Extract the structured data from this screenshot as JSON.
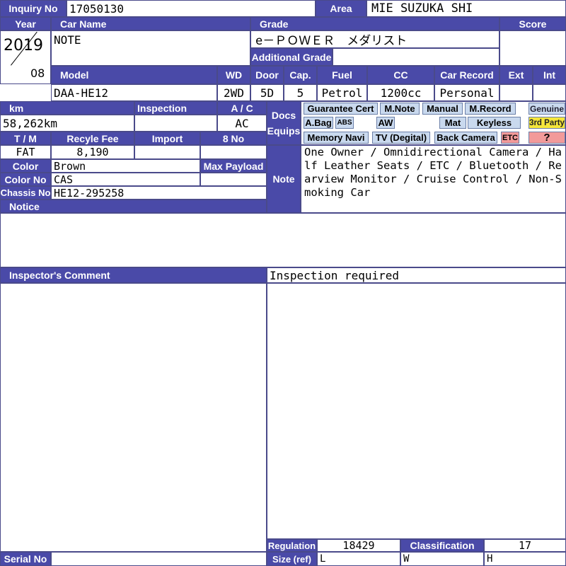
{
  "inquiry": {
    "label": "Inquiry No",
    "value": "17050130"
  },
  "area": {
    "label": "Area",
    "value": "MIE SUZUKA SHI"
  },
  "year": {
    "label": "Year",
    "value": "2019",
    "month": "08"
  },
  "car_name": {
    "label": "Car Name",
    "value": "NOTE"
  },
  "grade": {
    "label": "Grade",
    "value": "e－ＰＯＷＥＲ　メダリスト",
    "additional_label": "Additional Grade",
    "additional_value": ""
  },
  "score": {
    "label": "Score",
    "value": ""
  },
  "row2_headers": {
    "model": "Model",
    "wd": "WD",
    "door": "Door",
    "cap": "Cap.",
    "fuel": "Fuel",
    "cc": "CC",
    "car_record": "Car Record",
    "ext": "Ext",
    "int": "Int"
  },
  "row2_values": {
    "model": "DAA-HE12",
    "wd": "2WD",
    "door": "5D",
    "cap": "5",
    "fuel": "Petrol",
    "cc": "1200cc",
    "car_record": "Personal",
    "ext": "",
    "int": ""
  },
  "km": {
    "label": "km",
    "value": "58,262km"
  },
  "inspection": {
    "label": "Inspection",
    "value": ""
  },
  "ac": {
    "label": "A / C",
    "value": "AC"
  },
  "docs_equips": {
    "label1": "Docs",
    "label2": "Equips"
  },
  "tags": {
    "guarantee": "Guarantee Cert",
    "mnote": "M.Note",
    "manual": "Manual",
    "mrecord": "M.Record",
    "genuine": "Genuine",
    "abag": "A.Bag",
    "abs": "ABS",
    "aw": "AW",
    "mat": "Mat",
    "keyless": "Keyless",
    "third": "3rd Party",
    "navi": "Memory Navi",
    "tv": "TV (Degital)",
    "camera": "Back Camera",
    "etc": "ETC",
    "q": "?"
  },
  "tm": {
    "label": "T / M",
    "value": "FAT"
  },
  "recycle": {
    "label": "Recyle Fee",
    "value": "8,190"
  },
  "import": {
    "label": "Import",
    "value": ""
  },
  "eight_no": {
    "label": "8 No",
    "value": ""
  },
  "color": {
    "label": "Color",
    "value": "Brown"
  },
  "max_payload": {
    "label": "Max Payload",
    "value": ""
  },
  "color_no": {
    "label": "Color No",
    "value": "CAS"
  },
  "chassis": {
    "label": "Chassis No",
    "value": "HE12-295258"
  },
  "notice": {
    "label": "Notice"
  },
  "note": {
    "label": "Note",
    "text": "One Owner / Omnidirectional Camera / Half Leather Seats / ETC / Bluetooth / Rearview Monitor / Cruise Control / Non-Smoking Car"
  },
  "inspector": {
    "label": "Inspector's Comment",
    "value": "Inspection required"
  },
  "regulation": {
    "label": "Regulation",
    "value": "18429"
  },
  "classification": {
    "label": "Classification",
    "value": "17"
  },
  "size": {
    "label": "Size (ref)",
    "l": "L",
    "w": "W",
    "h": "H"
  },
  "serial": {
    "label": "Serial No",
    "value": ""
  },
  "colors": {
    "header_bg": "#4a4aa8",
    "tag_bg": "#c9d9ee",
    "etc_bg": "#f29a9a",
    "third_bg": "#f5e63a"
  }
}
